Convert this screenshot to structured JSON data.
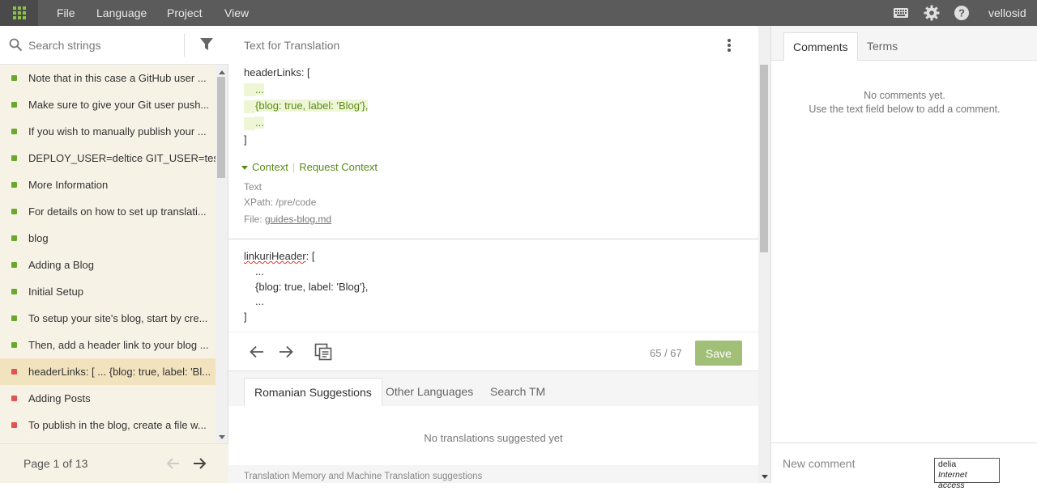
{
  "topbar": {
    "menu": [
      "File",
      "Language",
      "Project",
      "View"
    ],
    "user": "vellosid",
    "icons": [
      "apps-grid-icon",
      "keyboard-icon",
      "gear-icon",
      "help-icon"
    ]
  },
  "sidebar": {
    "search_placeholder": "Search strings",
    "items": [
      {
        "label": "Note that in this case a GitHub user ...",
        "status": "translated"
      },
      {
        "label": "Make sure to give your Git user push...",
        "status": "translated"
      },
      {
        "label": "If you wish to manually publish your ...",
        "status": "translated"
      },
      {
        "label": "DEPLOY_USER=deltice GIT_USER=tes...",
        "status": "translated"
      },
      {
        "label": "More Information",
        "status": "translated"
      },
      {
        "label": "For details on how to set up translati...",
        "status": "translated"
      },
      {
        "label": "blog",
        "status": "translated"
      },
      {
        "label": "Adding a Blog",
        "status": "translated"
      },
      {
        "label": "Initial Setup",
        "status": "translated"
      },
      {
        "label": "To setup your site's blog, start by cre...",
        "status": "translated"
      },
      {
        "label": "Then, add a header link to your blog ...",
        "status": "translated"
      },
      {
        "label": "headerLinks: [ ... {blog: true, label: 'Bl...",
        "status": "untranslated",
        "active": true
      },
      {
        "label": "Adding Posts",
        "status": "untranslated"
      },
      {
        "label": "To publish in the blog, create a file w...",
        "status": "untranslated"
      }
    ],
    "pager": "Page 1 of 13"
  },
  "editor": {
    "title": "Text for Translation",
    "source_lines": [
      "headerLinks: [",
      "...",
      "{blog: true, label: 'Blog'},",
      "...",
      "]"
    ],
    "context_label": "Context",
    "request_context": "Request Context",
    "context_type": "Text",
    "xpath": "XPath: /pre/code",
    "file_prefix": "File: ",
    "file_name": "guides-blog.md",
    "translation_word": "linkuriHeader",
    "translation_first_rest": ": [",
    "translation_lines": [
      "...",
      "{blog: true, label: 'Blog'},",
      "...",
      "]"
    ],
    "counter": "65 / 67",
    "save_label": "Save"
  },
  "suggestions": {
    "tabs": [
      "Romanian Suggestions",
      "Other Languages",
      "Search TM"
    ],
    "empty": "No translations suggested yet",
    "footer": "Translation Memory and Machine Translation suggestions"
  },
  "right": {
    "tabs": [
      "Comments",
      "Terms"
    ],
    "empty_line1": "No comments yet.",
    "empty_line2": "Use the text field below to add a comment.",
    "comment_placeholder": "New comment"
  },
  "tooltip": {
    "name": "delia",
    "status": "Internet access"
  },
  "colors": {
    "translated": "#6aa72f",
    "untranslated": "#e05454",
    "accent": "#8bc34a",
    "save": "#a2bf78"
  }
}
